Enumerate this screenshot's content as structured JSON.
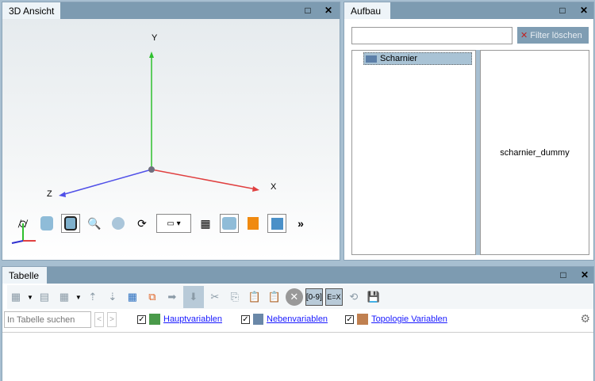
{
  "view3d": {
    "title": "3D Ansicht",
    "axis_x": "X",
    "axis_y": "Y",
    "axis_z": "Z",
    "more": "»"
  },
  "aufbau": {
    "title": "Aufbau",
    "filter_value": "",
    "filter_button": "Filter löschen",
    "tree_root": "Scharnier",
    "detail": "scharnier_dummy"
  },
  "tabelle": {
    "title": "Tabelle",
    "search_placeholder": "In Tabelle suchen",
    "prev": "<",
    "next": ">",
    "checks": [
      {
        "label": "Hauptvariablen",
        "checked": true
      },
      {
        "label": "Nebenvariablen",
        "checked": true
      },
      {
        "label": "Topologie Variablen",
        "checked": true
      }
    ],
    "btn_range": "[0-9]",
    "btn_formula": "E=X"
  },
  "window": {
    "maximize": "□",
    "close": "✕"
  }
}
